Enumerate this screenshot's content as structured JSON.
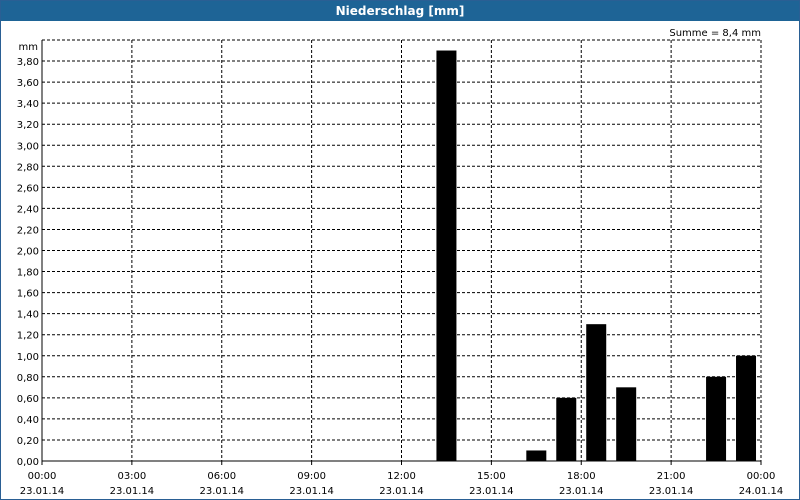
{
  "window": {
    "title": "Niederschlag [mm]"
  },
  "chart_data": {
    "type": "bar",
    "title": "Niederschlag [mm]",
    "ylabel": "mm",
    "summary": "Summe = 8,4 mm",
    "ylim": [
      0,
      4.0
    ],
    "yticks": [
      "0,00",
      "0,20",
      "0,40",
      "0,60",
      "0,80",
      "1,00",
      "1,20",
      "1,40",
      "1,60",
      "1,80",
      "2,00",
      "2,20",
      "2,40",
      "2,60",
      "2,80",
      "3,00",
      "3,20",
      "3,40",
      "3,60",
      "3,80"
    ],
    "xticks": [
      {
        "time": "00:00",
        "date": "23.01.14"
      },
      {
        "time": "03:00",
        "date": "23.01.14"
      },
      {
        "time": "06:00",
        "date": "23.01.14"
      },
      {
        "time": "09:00",
        "date": "23.01.14"
      },
      {
        "time": "12:00",
        "date": "23.01.14"
      },
      {
        "time": "15:00",
        "date": "23.01.14"
      },
      {
        "time": "18:00",
        "date": "23.01.14"
      },
      {
        "time": "21:00",
        "date": "23.01.14"
      },
      {
        "time": "00:00",
        "date": "24.01.14"
      }
    ],
    "xlim": [
      "23.01.14 00:00",
      "24.01.14 00:00"
    ],
    "grid": true,
    "bar_color": "#000000",
    "series": [
      {
        "values": [
          {
            "time": "23.01.14 13:00",
            "value": 3.9
          },
          {
            "time": "23.01.14 16:00",
            "value": 0.1
          },
          {
            "time": "23.01.14 17:00",
            "value": 0.6
          },
          {
            "time": "23.01.14 18:00",
            "value": 1.3
          },
          {
            "time": "23.01.14 19:00",
            "value": 0.7
          },
          {
            "time": "23.01.14 22:00",
            "value": 0.8
          },
          {
            "time": "23.01.14 23:00",
            "value": 1.0
          }
        ]
      }
    ]
  }
}
